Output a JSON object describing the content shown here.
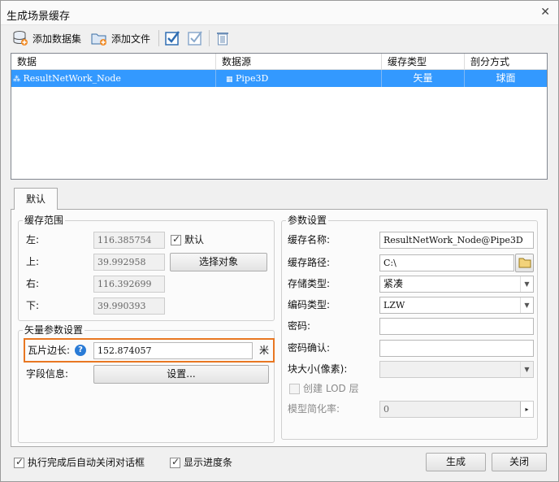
{
  "window": {
    "title": "生成场景缓存"
  },
  "toolbar": {
    "add_dataset": "添加数据集",
    "add_file": "添加文件"
  },
  "grid": {
    "columns": [
      "数据",
      "数据源",
      "缓存类型",
      "剖分方式"
    ],
    "rows": [
      {
        "data": "ResultNetWork_Node",
        "source": "Pipe3D",
        "cache_type": "矢量",
        "split": "球面"
      }
    ]
  },
  "tabs": [
    "默认"
  ],
  "cache_range": {
    "title": "缓存范围",
    "left_label": "左:",
    "left": "116.385754",
    "top_label": "上:",
    "top": "39.992958",
    "right_label": "右:",
    "right": "116.392699",
    "bottom_label": "下:",
    "bottom": "39.990393",
    "default_label": "默认",
    "select_object": "选择对象"
  },
  "vector_params": {
    "title": "矢量参数设置",
    "tile_label": "瓦片边长:",
    "tile_value": "152.874057",
    "tile_unit": "米",
    "field_label": "字段信息:",
    "settings_button": "设置..."
  },
  "params": {
    "title": "参数设置",
    "cache_name_label": "缓存名称:",
    "cache_name": "ResultNetWork_Node@Pipe3D",
    "cache_path_label": "缓存路径:",
    "cache_path": "C:\\",
    "storage_label": "存储类型:",
    "storage": "紧凑",
    "encoding_label": "编码类型:",
    "encoding": "LZW",
    "password_label": "密码:",
    "confirm_label": "密码确认:",
    "block_label": "块大小(像素):",
    "lod_label": "创建 LOD 层",
    "simplify_label": "模型简化率:",
    "simplify": "0"
  },
  "footer": {
    "auto_close": "执行完成后自动关闭对话框",
    "show_progress": "显示进度条",
    "generate": "生成",
    "close": "关闭"
  },
  "colors": {
    "selection": "#3399ff",
    "highlight": "#e87722"
  }
}
